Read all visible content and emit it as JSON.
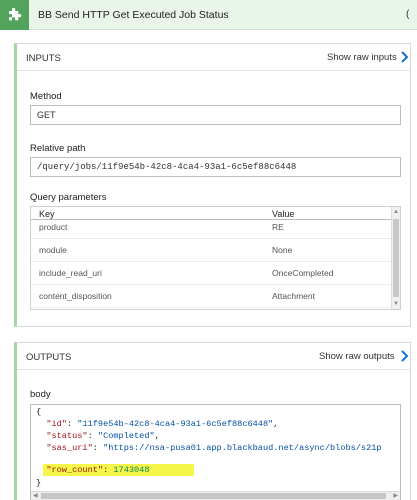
{
  "header": {
    "title": "BB Send HTTP Get Executed Job Status",
    "right_glyph": "(",
    "icon": "puzzle-icon",
    "accent_color": "#54a35c"
  },
  "inputs": {
    "title": "INPUTS",
    "raw_link": "Show raw inputs",
    "method_label": "Method",
    "method_value": "GET",
    "path_label": "Relative path",
    "path_value": "/query/jobs/11f9e54b-42c8-4ca4-93a1-6c5ef88c6448",
    "query_label": "Query parameters",
    "query_headers": {
      "key": "Key",
      "value": "Value"
    },
    "query_rows": [
      {
        "key": "product",
        "value": "RE"
      },
      {
        "key": "module",
        "value": "None"
      },
      {
        "key": "include_read_uri",
        "value": "OnceCompleted"
      },
      {
        "key": "content_disposition",
        "value": "Attachment"
      }
    ]
  },
  "outputs": {
    "title": "OUTPUTS",
    "raw_link": "Show raw outputs",
    "body_label": "body",
    "code": {
      "open_brace": "{",
      "id_key": "\"id\"",
      "id_value": "\"11f9e54b-42c8-4ca4-93a1-6c5ef88c6448\"",
      "status_key": "\"status\"",
      "status_value": "\"Completed\"",
      "sas_key": "\"sas_uri\"",
      "sas_value": "\"https://nsa-pusa01.app.blackbaud.net/async/blobs/s21p",
      "row_count_key": "\"row_count\"",
      "row_count_value": "1743048",
      "close_brace": "}",
      "colon": ": ",
      "comma": ","
    }
  }
}
